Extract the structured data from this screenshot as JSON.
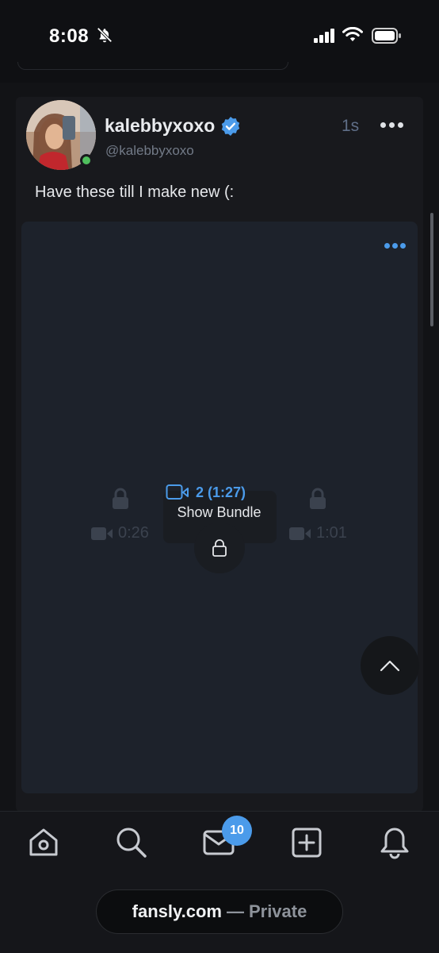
{
  "status_bar": {
    "time": "8:08",
    "icons": [
      "bell-slash-icon",
      "cellular-signal-icon",
      "wifi-icon",
      "battery-icon"
    ]
  },
  "post": {
    "author": {
      "display_name": "kalebbyxoxo",
      "handle": "@kalebbyxoxo",
      "verified": true,
      "online": true
    },
    "time_ago": "1s",
    "text": "Have these till I make new (:",
    "media": {
      "left_duration": "0:26",
      "right_duration": "1:01",
      "bundle_count": "2 (1:27)",
      "show_bundle_label": "Show Bundle"
    }
  },
  "bottom_nav": {
    "items": [
      "home-icon",
      "search-icon",
      "messages-icon",
      "create-post-icon",
      "notifications-icon"
    ],
    "messages_badge": "10"
  },
  "browser": {
    "domain": "fansly.com",
    "separator": "—",
    "mode": "Private"
  },
  "colors": {
    "accent": "#4b9bea",
    "online": "#4fbf5e",
    "background": "#121316",
    "card": "#18191d"
  }
}
